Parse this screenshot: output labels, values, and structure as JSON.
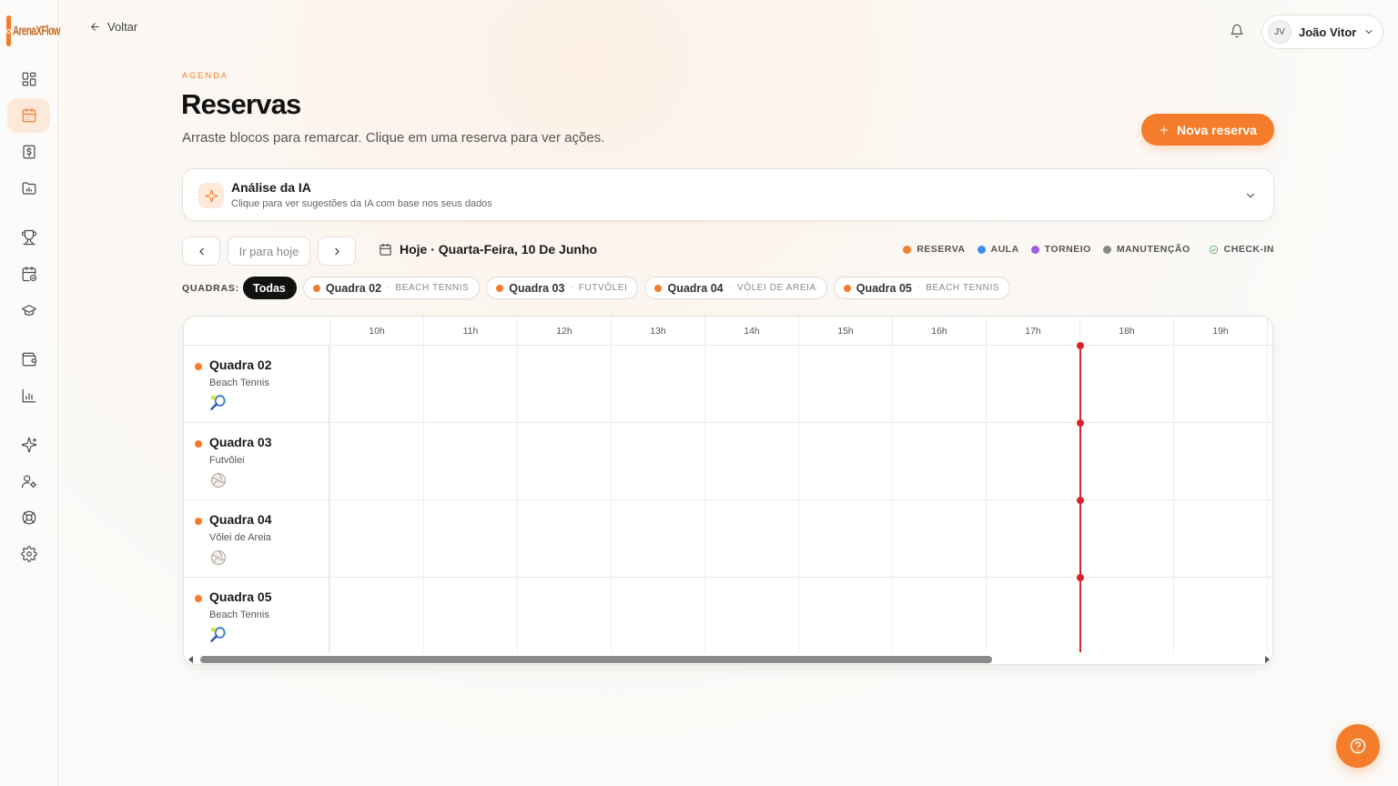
{
  "brand": {
    "logo_text": "ArenaXFlow",
    "accent": "#f47c2a"
  },
  "topbar": {
    "back_label": "Voltar",
    "user": {
      "initials": "JV",
      "name": "João Vitor"
    }
  },
  "header": {
    "eyebrow": "AGENDA",
    "title": "Reservas",
    "subtitle": "Arraste blocos para remarcar. Clique em uma reserva para ver ações.",
    "new_button": "Nova reserva"
  },
  "ai_card": {
    "title": "Análise da IA",
    "description": "Clique para ver sugestões da IA com base nos seus dados"
  },
  "date_nav": {
    "today_button": "Ir para hoje",
    "current_date": "Hoje · Quarta-Feira, 10 De Junho"
  },
  "legend": [
    {
      "label": "RESERVA",
      "color": "#f47c2a"
    },
    {
      "label": "AULA",
      "color": "#3b8ef0"
    },
    {
      "label": "TORNEIO",
      "color": "#9b5de5"
    },
    {
      "label": "MANUTENÇÃO",
      "color": "#8a8a8a"
    },
    {
      "label": "CHECK-IN",
      "color": "#2ea043"
    }
  ],
  "filters": {
    "label": "QUADRAS:",
    "all": "Todas",
    "courts": [
      {
        "name": "Quadra 02",
        "type": "BEACH TENNIS"
      },
      {
        "name": "Quadra 03",
        "type": "FUTVÔLEI"
      },
      {
        "name": "Quadra 04",
        "type": "VÔLEI DE AREIA"
      },
      {
        "name": "Quadra 05",
        "type": "BEACH TENNIS"
      }
    ]
  },
  "schedule": {
    "hours": [
      "10h",
      "11h",
      "12h",
      "13h",
      "14h",
      "15h",
      "16h",
      "17h",
      "18h",
      "19h"
    ],
    "current_time_hour": 18.0,
    "courts": [
      {
        "name": "Quadra 02",
        "type": "Beach Tennis",
        "icon": "tennis-racket-icon"
      },
      {
        "name": "Quadra 03",
        "type": "Futvôlei",
        "icon": "volleyball-icon"
      },
      {
        "name": "Quadra 04",
        "type": "Vôlei de Areia",
        "icon": "volleyball-icon"
      },
      {
        "name": "Quadra 05",
        "type": "Beach Tennis",
        "icon": "tennis-racket-icon"
      }
    ]
  }
}
